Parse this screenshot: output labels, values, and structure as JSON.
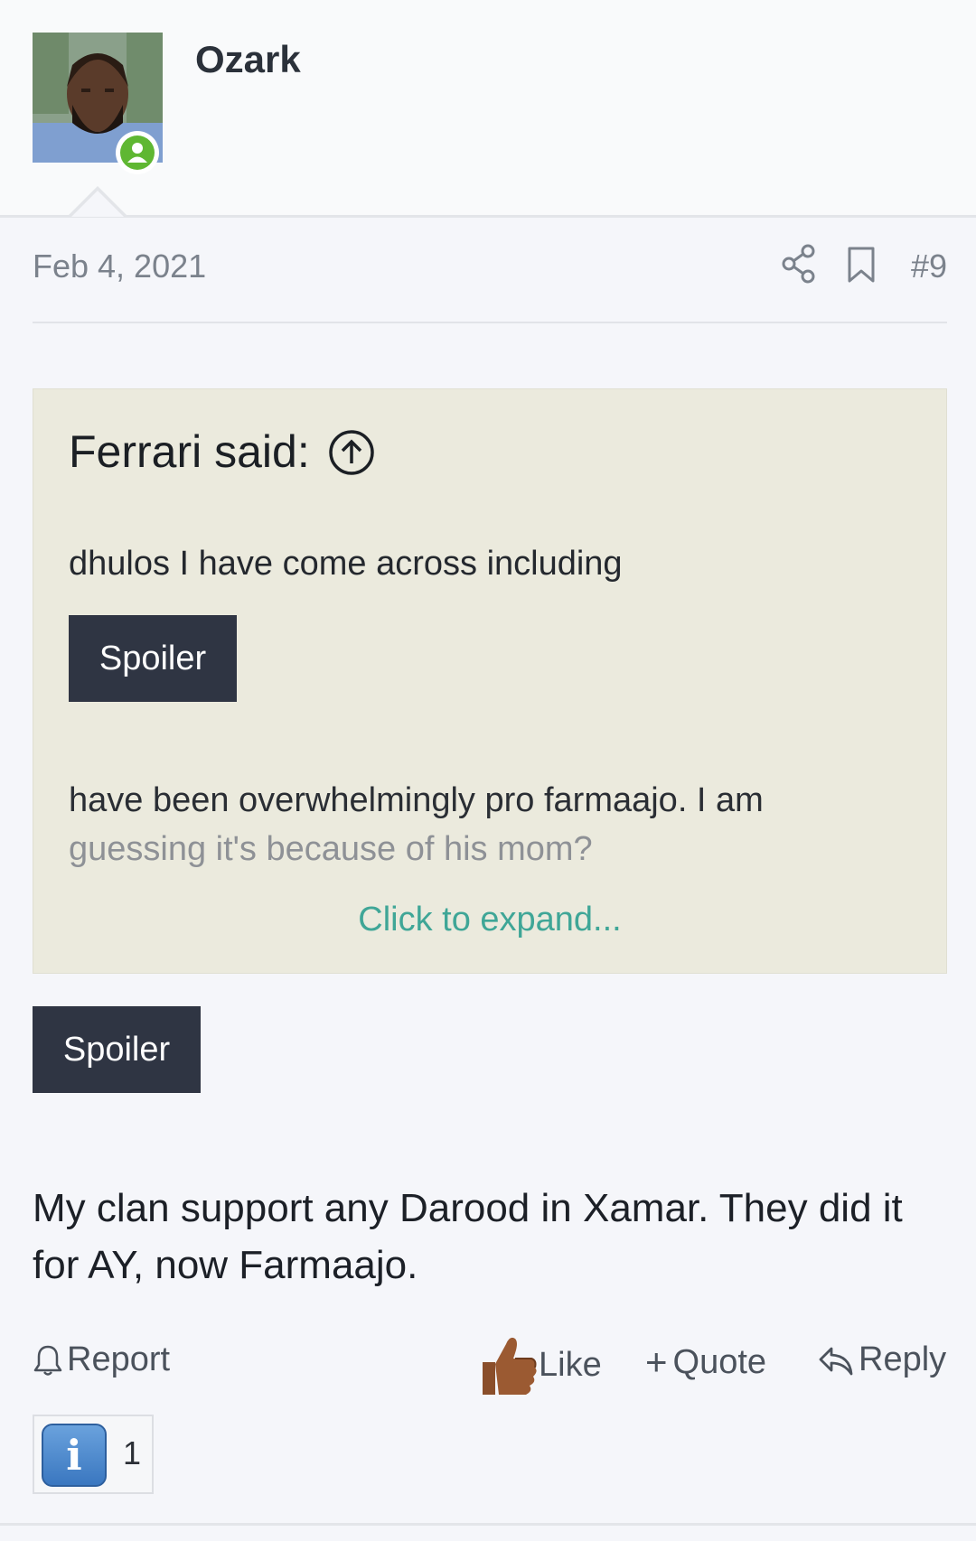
{
  "post": {
    "username": "Ozark",
    "date": "Feb 4, 2021",
    "post_number": "#9",
    "quote": {
      "title": "Ferrari said:",
      "line1": "dhulos I have come across including",
      "spoiler_label": "Spoiler",
      "line2": "have been overwhelmingly pro farmaajo. I am",
      "line3": "guessing it's because of his mom?",
      "expand_label": "Click to expand..."
    },
    "spoiler_label": "Spoiler",
    "body_text": "My clan support any Darood in Xamar. They did it for AY, now Farmaajo."
  },
  "actions": {
    "report": "Report",
    "like": "Like",
    "quote": "Quote",
    "reply": "Reply"
  },
  "reactions": {
    "icon": "info-icon",
    "count": "1"
  },
  "colors": {
    "online": "#5fb732",
    "quote_bg": "#ebeadd",
    "spoiler_bg": "#2f3543",
    "expand_link": "#3fa697"
  }
}
